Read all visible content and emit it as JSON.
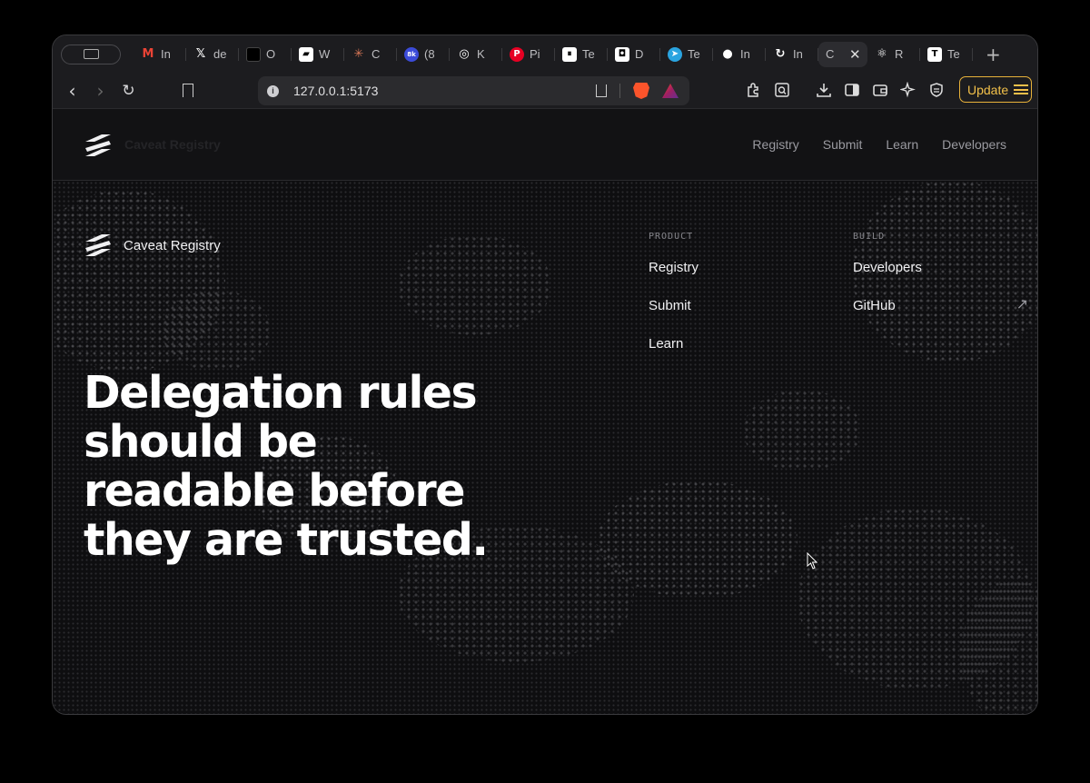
{
  "browser": {
    "tabs": [
      {
        "favicon": "gmail-icon",
        "title": "In",
        "color": "#ea4335"
      },
      {
        "favicon": "x-icon",
        "title": "de",
        "color": "#ffffff"
      },
      {
        "favicon": "black-square-icon",
        "title": "O",
        "color": "#000000"
      },
      {
        "favicon": "w-logo-icon",
        "title": "W",
        "color": "#ffffff"
      },
      {
        "favicon": "claude-icon",
        "title": "C",
        "color": "#d97757"
      },
      {
        "favicon": "badge-icon",
        "title": "(8",
        "color": "#3b4bd8"
      },
      {
        "favicon": "openai-icon",
        "title": "K",
        "color": "#ffffff"
      },
      {
        "favicon": "pinterest-icon",
        "title": "Pi",
        "color": "#e60023"
      },
      {
        "favicon": "pause-icon",
        "title": "Te",
        "color": "#ffffff"
      },
      {
        "favicon": "d-logo-icon",
        "title": "D",
        "color": "#ffffff"
      },
      {
        "favicon": "telegram-icon",
        "title": "Te",
        "color": "#2aa4e0"
      },
      {
        "favicon": "github-icon",
        "title": "In",
        "color": "#ffffff"
      },
      {
        "favicon": "refresh-logo-icon",
        "title": "In",
        "color": "#ffffff"
      },
      {
        "favicon": "",
        "title": "C",
        "active": true
      },
      {
        "favicon": "react-icon",
        "title": "R",
        "color": "#ffffff"
      },
      {
        "favicon": "t-logo-icon",
        "title": "Te",
        "color": "#ffffff"
      }
    ],
    "new_tab": "+",
    "url": "127.0.0.1:5173",
    "info_glyph": "i",
    "update_label": "Update"
  },
  "site": {
    "brand_name": "Caveat Registry",
    "nav": [
      "Registry",
      "Submit",
      "Learn",
      "Developers"
    ],
    "footer": {
      "product_heading": "PRODUCT",
      "product_links": [
        "Registry",
        "Submit",
        "Learn"
      ],
      "build_heading": "BUILD",
      "build_links": [
        "Developers",
        "GitHub"
      ]
    },
    "hero": "Delegation rules should be readable before they are trusted."
  }
}
